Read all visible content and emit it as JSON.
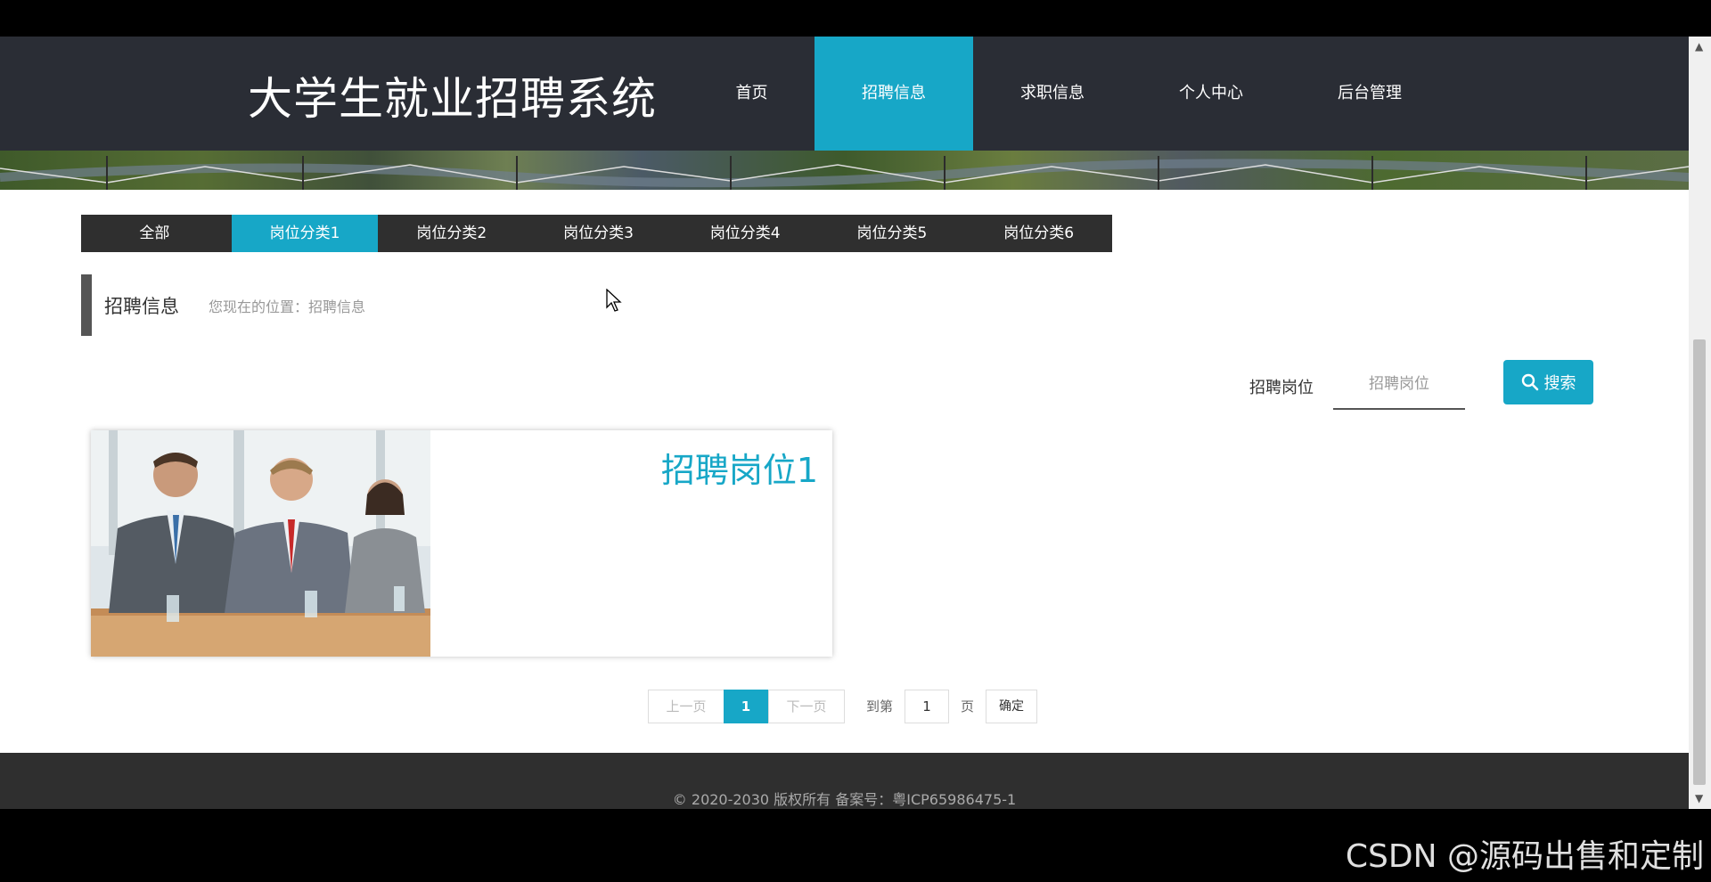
{
  "site": {
    "title": "大学生就业招聘系统"
  },
  "nav": {
    "items": [
      {
        "label": "首页"
      },
      {
        "label": "招聘信息",
        "active": true
      },
      {
        "label": "求职信息"
      },
      {
        "label": "个人中心"
      },
      {
        "label": "后台管理"
      }
    ]
  },
  "categories": [
    {
      "label": "全部"
    },
    {
      "label": "岗位分类1",
      "active": true
    },
    {
      "label": "岗位分类2"
    },
    {
      "label": "岗位分类3"
    },
    {
      "label": "岗位分类4"
    },
    {
      "label": "岗位分类5"
    },
    {
      "label": "岗位分类6"
    }
  ],
  "section": {
    "title": "招聘信息",
    "breadcrumb": "您现在的位置：招聘信息"
  },
  "search": {
    "label": "招聘岗位",
    "placeholder": "招聘岗位",
    "button_label": "搜索",
    "button_icon": "search-icon"
  },
  "cards": [
    {
      "title": "招聘岗位1"
    }
  ],
  "pagination": {
    "prev": "上一页",
    "current": "1",
    "next": "下一页",
    "goto_prefix": "到第",
    "goto_value": "1",
    "goto_suffix": "页",
    "confirm": "确定"
  },
  "footer": {
    "text": "© 2020-2030 版权所有 备案号：粤ICP65986475-1"
  },
  "watermark": "CSDN @源码出售和定制",
  "colors": {
    "accent": "#17a7c7",
    "header_bg": "#2a2d35",
    "dark_bar": "#2f2f2f"
  }
}
